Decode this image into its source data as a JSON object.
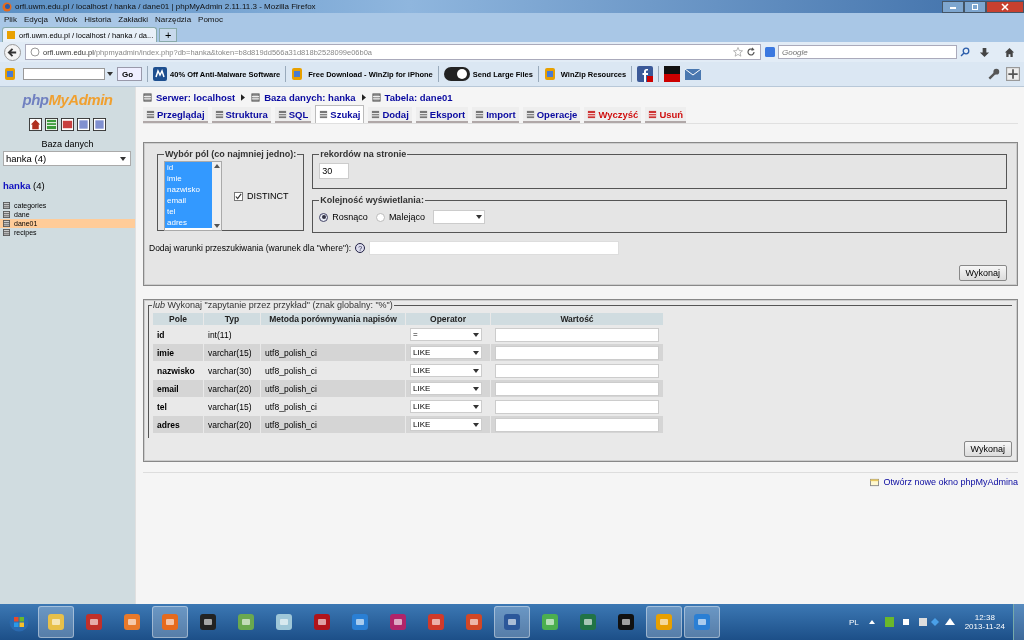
{
  "window": {
    "title": "orfi.uwm.edu.pl / localhost / hanka / dane01 | phpMyAdmin 2.11.11.3 - Mozilla Firefox"
  },
  "menu": [
    "Plik",
    "Edycja",
    "Widok",
    "Historia",
    "Zakładki",
    "Narzędzia",
    "Pomoc"
  ],
  "browser_tabs": [
    {
      "label": "orfi.uwm.edu.pl / localhost / hanka / da...",
      "selected": true
    }
  ],
  "new_tab": "+",
  "address": {
    "host": "orfi.uwm.edu.pl",
    "path": "/phpmyadmin/index.php?db=hanka&token=b8d819dd566a31d818b2528099e06b0a"
  },
  "search": {
    "placeholder": "Google"
  },
  "toolbar": {
    "go": "Go",
    "bookmarks": [
      "40% Off Anti-Malware Software",
      "Free Download - WinZip for iPhone",
      "Send Large Files",
      "WinZip Resources"
    ]
  },
  "sidebar": {
    "logo_a": "php",
    "logo_b": "MyAdmin",
    "db_label": "Baza danych",
    "db_select": "hanka (4)",
    "db_name": "hanka",
    "db_count": "(4)",
    "tables": [
      {
        "name": "categories",
        "selected": false
      },
      {
        "name": "dane",
        "selected": false
      },
      {
        "name": "dane01",
        "selected": true
      },
      {
        "name": "recipes",
        "selected": false
      }
    ]
  },
  "breadcrumb": [
    "Serwer: localhost",
    "Baza danych: hanka",
    "Tabela: dane01"
  ],
  "tabs": [
    {
      "label": "Przeglądaj",
      "selected": false,
      "kind": "normal"
    },
    {
      "label": "Struktura",
      "selected": false,
      "kind": "normal"
    },
    {
      "label": "SQL",
      "selected": false,
      "kind": "normal"
    },
    {
      "label": "Szukaj",
      "selected": true,
      "kind": "normal"
    },
    {
      "label": "Dodaj",
      "selected": false,
      "kind": "normal"
    },
    {
      "label": "Eksport",
      "selected": false,
      "kind": "normal"
    },
    {
      "label": "Import",
      "selected": false,
      "kind": "normal"
    },
    {
      "label": "Operacje",
      "selected": false,
      "kind": "normal"
    },
    {
      "label": "Wyczyść",
      "selected": false,
      "kind": "danger"
    },
    {
      "label": "Usuń",
      "selected": false,
      "kind": "danger"
    }
  ],
  "fields_box": {
    "legend": "Wybór pól (co najmniej jedno):",
    "fields": [
      {
        "name": "id",
        "selected": true
      },
      {
        "name": "imie",
        "selected": true
      },
      {
        "name": "nazwisko",
        "selected": true
      },
      {
        "name": "email",
        "selected": true
      },
      {
        "name": "tel",
        "selected": true
      },
      {
        "name": "adres",
        "selected": true
      }
    ],
    "distinct": {
      "label": "DISTINCT",
      "checked": true
    }
  },
  "per_page": {
    "legend": "rekordów na stronie",
    "value": "30"
  },
  "order": {
    "legend": "Kolejność wyświetlania:",
    "options": [
      {
        "label": "Rosnąco",
        "selected": true
      },
      {
        "label": "Malejąco",
        "selected": false
      }
    ]
  },
  "where": {
    "label": "Dodaj warunki przeszukiwania (warunek dla \"where\"):",
    "help": "?"
  },
  "submit_1": "Wykonaj",
  "qbe": {
    "legend": "*lub* Wykonaj \"zapytanie przez przykład\" (znak globalny: \"%\")",
    "columns": [
      "Pole",
      "Typ",
      "Metoda porównywania napisów",
      "Operator",
      "Wartość"
    ],
    "rows": [
      {
        "field": "id",
        "type": "int(11)",
        "operator": "="
      },
      {
        "field": "imie",
        "type": "varchar(15)",
        "collation": "utf8_polish_ci",
        "operator": "LIKE"
      },
      {
        "field": "nazwisko",
        "type": "varchar(30)",
        "collation": "utf8_polish_ci",
        "operator": "LIKE"
      },
      {
        "field": "email",
        "type": "varchar(20)",
        "collation": "utf8_polish_ci",
        "operator": "LIKE"
      },
      {
        "field": "tel",
        "type": "varchar(15)",
        "collation": "utf8_polish_ci",
        "operator": "LIKE"
      },
      {
        "field": "adres",
        "type": "varchar(20)",
        "collation": "utf8_polish_ci",
        "operator": "LIKE"
      }
    ]
  },
  "submit_2": "Wykonaj",
  "footer_link": "Otwórz nowe okno phpMyAdmina",
  "taskbar": {
    "language": "PL",
    "time": "12:38",
    "date": "2013-11-24"
  }
}
